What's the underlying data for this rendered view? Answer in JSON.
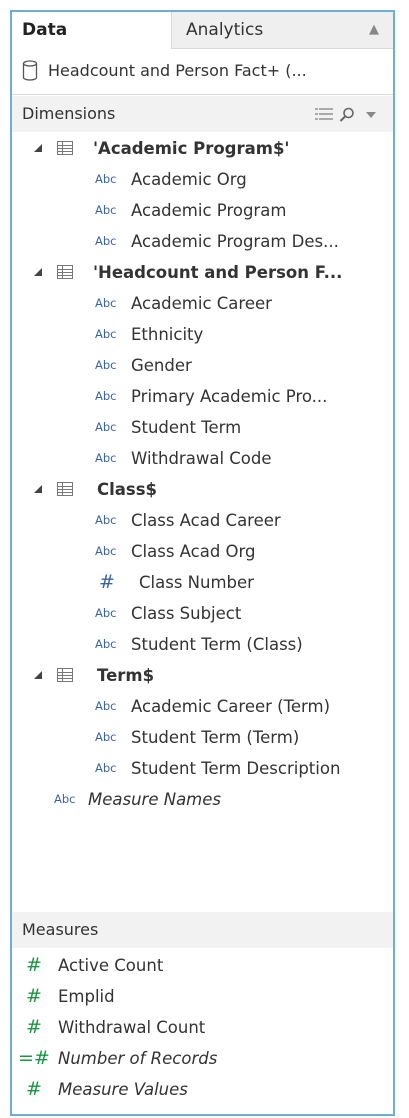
{
  "tabs": {
    "data": "Data",
    "analytics": "Analytics"
  },
  "data_source": {
    "name": "Headcount and Person Fact+ (..."
  },
  "dimensions": {
    "header": "Dimensions",
    "tables": [
      {
        "name": "'Academic Program$'",
        "fields": [
          {
            "type": "Abc",
            "name": "Academic Org"
          },
          {
            "type": "Abc",
            "name": "Academic Program"
          },
          {
            "type": "Abc",
            "name": "Academic Program Des..."
          }
        ]
      },
      {
        "name": "'Headcount and Person F...",
        "fields": [
          {
            "type": "Abc",
            "name": "Academic Career"
          },
          {
            "type": "Abc",
            "name": "Ethnicity"
          },
          {
            "type": "Abc",
            "name": "Gender"
          },
          {
            "type": "Abc",
            "name": "Primary Academic Pro..."
          },
          {
            "type": "Abc",
            "name": "Student Term"
          },
          {
            "type": "Abc",
            "name": "Withdrawal Code"
          }
        ]
      },
      {
        "name": "Class$",
        "fields": [
          {
            "type": "Abc",
            "name": "Class Acad Career"
          },
          {
            "type": "Abc",
            "name": "Class Acad Org"
          },
          {
            "type": "#",
            "name": "Class Number"
          },
          {
            "type": "Abc",
            "name": "Class Subject"
          },
          {
            "type": "Abc",
            "name": "Student Term (Class)"
          }
        ]
      },
      {
        "name": "Term$",
        "fields": [
          {
            "type": "Abc",
            "name": "Academic Career (Term)"
          },
          {
            "type": "Abc",
            "name": "Student Term (Term)"
          },
          {
            "type": "Abc",
            "name": "Student Term Description"
          }
        ]
      }
    ],
    "extra": {
      "type": "Abc",
      "name": "Measure Names"
    }
  },
  "measures": {
    "header": "Measures",
    "items": [
      {
        "type": "#",
        "name": "Active Count",
        "italic": false
      },
      {
        "type": "#",
        "name": "Emplid",
        "italic": false
      },
      {
        "type": "#",
        "name": "Withdrawal Count",
        "italic": false
      },
      {
        "type": "=#",
        "name": "Number of Records",
        "italic": true
      },
      {
        "type": "#",
        "name": "Measure Values",
        "italic": true
      }
    ]
  },
  "colors": {
    "panel_border": "#6baed6",
    "abc_blue": "#3a63a6",
    "measure_green": "#1a9641",
    "dimension_blue": "#3a63a6",
    "header_bg": "#f2f2f2"
  },
  "icons": {
    "table": "table-icon",
    "expand": "triangle-expanded-icon",
    "source": "database-cylinder-icon",
    "view": "list-view-icon",
    "search": "search-icon",
    "menu": "dropdown-arrow-icon"
  }
}
